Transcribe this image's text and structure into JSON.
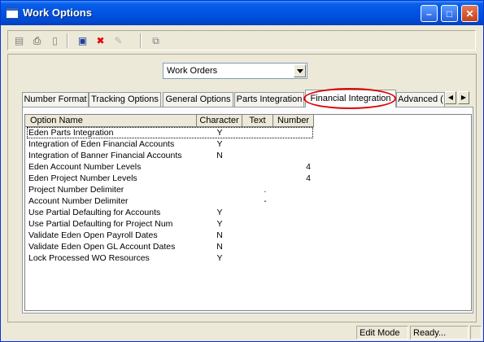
{
  "window": {
    "title": "Work Options"
  },
  "toolbar": {
    "buttons": [
      {
        "name": "grid-icon",
        "glyph": "▤",
        "enabled": false
      },
      {
        "name": "print-icon",
        "glyph": "⎙",
        "enabled": true
      },
      {
        "name": "document-icon",
        "glyph": "▯",
        "enabled": false
      },
      {
        "name": "save-icon",
        "glyph": "▣",
        "enabled": true
      },
      {
        "name": "delete-icon",
        "glyph": "✖",
        "enabled": true
      },
      {
        "name": "edit-icon",
        "glyph": "✎",
        "enabled": false
      },
      {
        "name": "export-icon",
        "glyph": "⧉",
        "enabled": false
      }
    ]
  },
  "selector": {
    "value": "Work Orders"
  },
  "tabs": [
    {
      "label": "Number Format"
    },
    {
      "label": "Tracking Options"
    },
    {
      "label": "General Options"
    },
    {
      "label": "Parts Integration"
    },
    {
      "label": "Financial Integration",
      "active": true
    },
    {
      "label": "Advanced ("
    }
  ],
  "grid": {
    "columns": [
      "Option Name",
      "Character",
      "Text",
      "Number"
    ],
    "rows": [
      {
        "name": "Eden Parts Integration",
        "character": "Y",
        "text": "",
        "number": ""
      },
      {
        "name": "Integration of Eden Financial Accounts",
        "character": "Y",
        "text": "",
        "number": ""
      },
      {
        "name": "Integration of Banner Financial Accounts",
        "character": "N",
        "text": "",
        "number": ""
      },
      {
        "name": "Eden Account Number Levels",
        "character": "",
        "text": "",
        "number": "4"
      },
      {
        "name": "Eden Project Number Levels",
        "character": "",
        "text": "",
        "number": "4"
      },
      {
        "name": "Project Number Delimiter",
        "character": "",
        "text": ".",
        "number": ""
      },
      {
        "name": "Account Number Delimiter",
        "character": "",
        "text": "-",
        "number": ""
      },
      {
        "name": "Use Partial Defaulting for Accounts",
        "character": "Y",
        "text": "",
        "number": ""
      },
      {
        "name": "Use Partial Defaulting for Project Num",
        "character": "Y",
        "text": "",
        "number": ""
      },
      {
        "name": "Validate Eden Open Payroll Dates",
        "character": "N",
        "text": "",
        "number": ""
      },
      {
        "name": "Validate Eden Open GL Account Dates",
        "character": "N",
        "text": "",
        "number": ""
      },
      {
        "name": "Lock Processed WO Resources",
        "character": "Y",
        "text": "",
        "number": ""
      }
    ]
  },
  "status": {
    "mode": "Edit Mode",
    "message": "Ready..."
  },
  "colors": {
    "title_bar": "#0054e3",
    "highlight": "#e00000",
    "chrome": "#ece9d8"
  }
}
